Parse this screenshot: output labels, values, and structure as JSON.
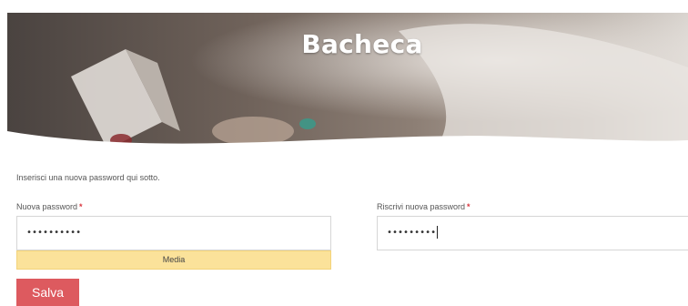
{
  "header": {
    "title": "Bacheca"
  },
  "form": {
    "intro_text": "Inserisci una nuova password qui sotto.",
    "new_password": {
      "label": "Nuova password",
      "required_mark": "*",
      "masked_value": "••••••••••"
    },
    "confirm_password": {
      "label": "Riscrivi nuova password",
      "required_mark": "*",
      "masked_value": "•••••••••"
    },
    "strength_meter": {
      "label": "Media",
      "color": "#fbe29a"
    },
    "save_label": "Salva"
  },
  "colors": {
    "accent": "#dd5a5f",
    "required": "#d9363e"
  }
}
